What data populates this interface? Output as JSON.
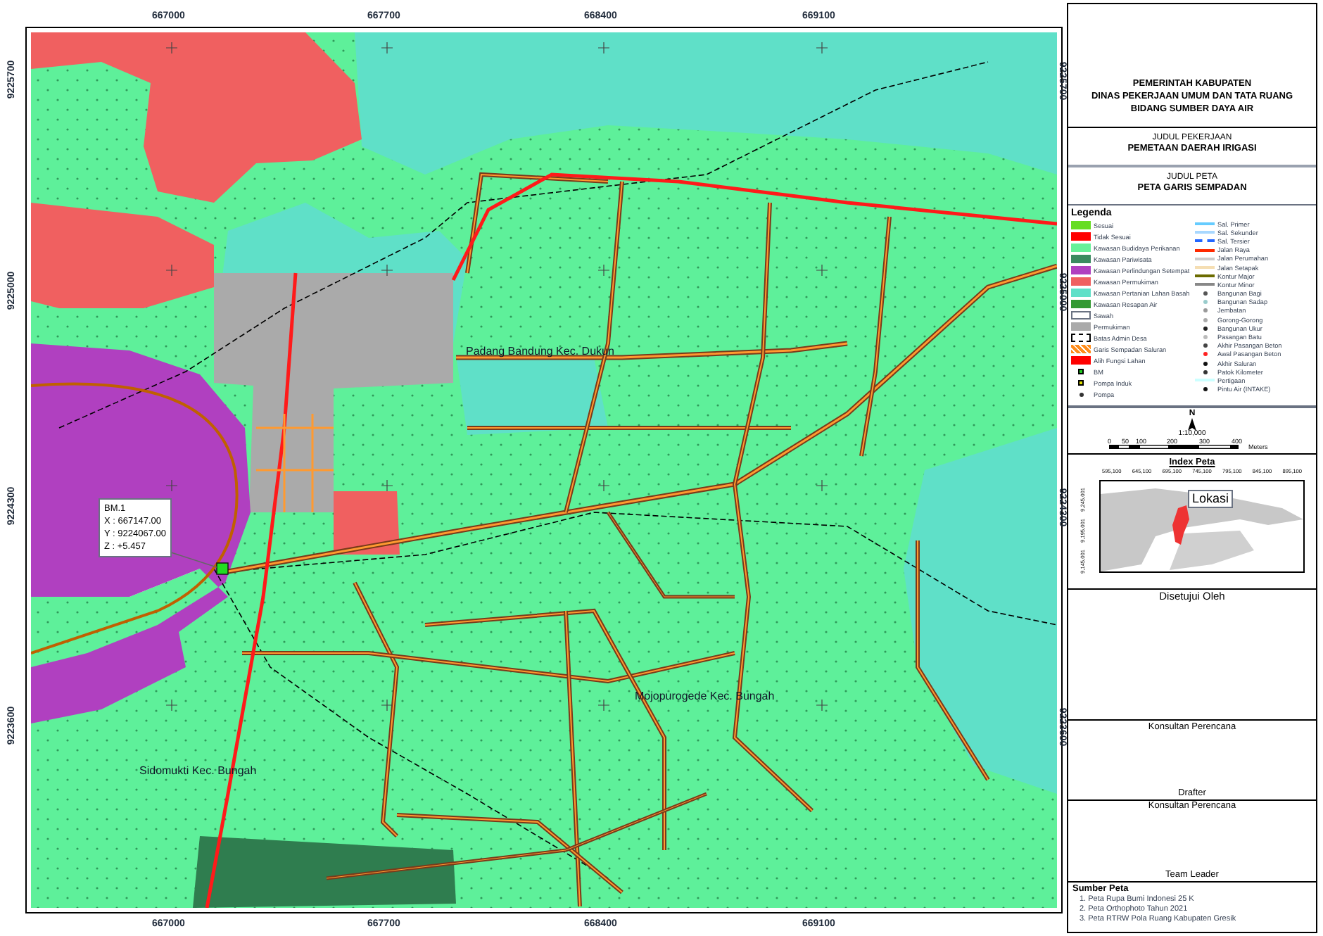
{
  "map": {
    "top_ticks": [
      "667000",
      "667700",
      "668400",
      "669100"
    ],
    "bottom_ticks": [
      "667000",
      "667700",
      "668400",
      "669100"
    ],
    "left_ticks": [
      "9225700",
      "9225000",
      "9224300",
      "9223600"
    ],
    "right_ticks": [
      "9225700",
      "9225000",
      "9224300",
      "9223600"
    ],
    "place_labels": [
      {
        "text": "Padang Bandung Kec. Dukun"
      },
      {
        "text": "Mojopurogede Kec. Bungah"
      },
      {
        "text": "Sidomukti Kec. Bungah"
      }
    ],
    "callout": [
      "BM.1",
      "X : 667147.00",
      "Y : 9224067.00",
      "Z : +5.457"
    ]
  },
  "panel": {
    "header": [
      "PEMERINTAH KABUPATEN",
      "DINAS PEKERJAAN UMUM DAN TATA RUANG",
      "BIDANG SUMBER DAYA AIR"
    ],
    "project_label": "JUDUL PEKERJAAN",
    "project_title": "PEMETAAN DAERAH IRIGASI",
    "map_label": "JUDUL PETA",
    "map_title": "PETA GARIS SEMPADAN",
    "legend_title": "Legenda",
    "legend_left": [
      {
        "label": "Sesuai",
        "kind": "fill",
        "color": "#66dd22"
      },
      {
        "label": "Tidak Sesuai",
        "kind": "fill",
        "color": "#ff0000"
      },
      {
        "label": "Kawasan Budidaya Perikanan",
        "kind": "fill",
        "color": "#66f099"
      },
      {
        "label": "Kawasan Pariwisata",
        "kind": "fill",
        "color": "#3a8a60"
      },
      {
        "label": "Kawasan Perlindungan Setempat",
        "kind": "fill",
        "color": "#b040c0"
      },
      {
        "label": "Kawasan Permukiman",
        "kind": "fill",
        "color": "#f06060"
      },
      {
        "label": "Kawasan Pertanian Lahan Basah",
        "kind": "fill",
        "color": "#5fe0c8"
      },
      {
        "label": "Kawasan Resapan Air",
        "kind": "fill",
        "color": "#339933"
      },
      {
        "label": "Sawah",
        "kind": "dots",
        "color": "#ffffff"
      },
      {
        "label": "Permukiman",
        "kind": "fill",
        "color": "#aaaaaa"
      },
      {
        "label": "Batas Admin Desa",
        "kind": "dashed",
        "color": "#000000"
      },
      {
        "label": "Garis Sempadan Saluran",
        "kind": "hatch",
        "color": "#ff8c1a"
      },
      {
        "label": "Alih Fungsi Lahan",
        "kind": "fill",
        "color": "#ff0000"
      },
      {
        "label": "BM",
        "kind": "marker",
        "color": "#22cc22"
      },
      {
        "label": "Pompa Induk",
        "kind": "marker",
        "color": "#dddd00"
      },
      {
        "label": "Pompa",
        "kind": "point",
        "color": "#333333"
      }
    ],
    "legend_right": [
      {
        "label": "Sal. Primer",
        "kind": "line",
        "color": "#66ccff"
      },
      {
        "label": "Sal. Sekunder",
        "kind": "line",
        "color": "#a8d8ff"
      },
      {
        "label": "Sal. Tersier",
        "kind": "dashline",
        "color": "#2266ff"
      },
      {
        "label": "Jalan Raya",
        "kind": "line",
        "color": "#ff2a00"
      },
      {
        "label": "Jalan Perumahan",
        "kind": "line",
        "color": "#cccccc"
      },
      {
        "label": "Jalan Setapak",
        "kind": "line",
        "color": "#f5deb3"
      },
      {
        "label": "Kontur Major",
        "kind": "line",
        "color": "#6b6b00"
      },
      {
        "label": "Kontur Minor",
        "kind": "line",
        "color": "#888888"
      },
      {
        "label": "Bangunan Bagi",
        "kind": "point",
        "color": "#555555"
      },
      {
        "label": "Bangunan Sadap",
        "kind": "point",
        "color": "#99cccc"
      },
      {
        "label": "Jembatan",
        "kind": "point",
        "color": "#999999"
      },
      {
        "label": "Gorong-Gorong",
        "kind": "point",
        "color": "#aaaaaa"
      },
      {
        "label": "Bangunan Ukur",
        "kind": "point",
        "color": "#222222"
      },
      {
        "label": "Pasangan Batu",
        "kind": "point",
        "color": "#bbbbbb"
      },
      {
        "label": "Akhir Pasangan Beton",
        "kind": "point",
        "color": "#444444"
      },
      {
        "label": "Awal Pasangan Beton",
        "kind": "point",
        "color": "#ff2222"
      },
      {
        "label": "Akhir Saluran",
        "kind": "point",
        "color": "#111111"
      },
      {
        "label": "Patok Kilometer",
        "kind": "point",
        "color": "#333333"
      },
      {
        "label": "Pertigaan",
        "kind": "line",
        "color": "#ccffff"
      },
      {
        "label": "Pintu Air (INTAKE)",
        "kind": "point",
        "color": "#111111"
      }
    ],
    "north": "N",
    "scale": "1:10,000",
    "scale_ticks": [
      "0",
      "50",
      "100",
      "200",
      "300",
      "400"
    ],
    "scale_unit": "Meters",
    "index_title": "Index Peta",
    "index_xticks": [
      "595,100",
      "645,100",
      "695,100",
      "745,100",
      "795,100",
      "845,100",
      "895,100"
    ],
    "index_yticks": [
      "9,245,001",
      "9,195,001",
      "9,145,001"
    ],
    "index_callout": "Lokasi",
    "approved": "Disetujui Oleh",
    "consultant": "Konsultan Perencana",
    "drafter": "Drafter",
    "consultant_2": "Konsultan Perencana",
    "team_leader": "Team Leader",
    "sources_title": "Sumber Peta",
    "sources": [
      "1. Peta Rupa Bumi Indonesi 25 K",
      "2. Peta Orthophoto Tahun 2021",
      "3. Peta RTRW Pola Ruang Kabupaten Gresik"
    ]
  }
}
